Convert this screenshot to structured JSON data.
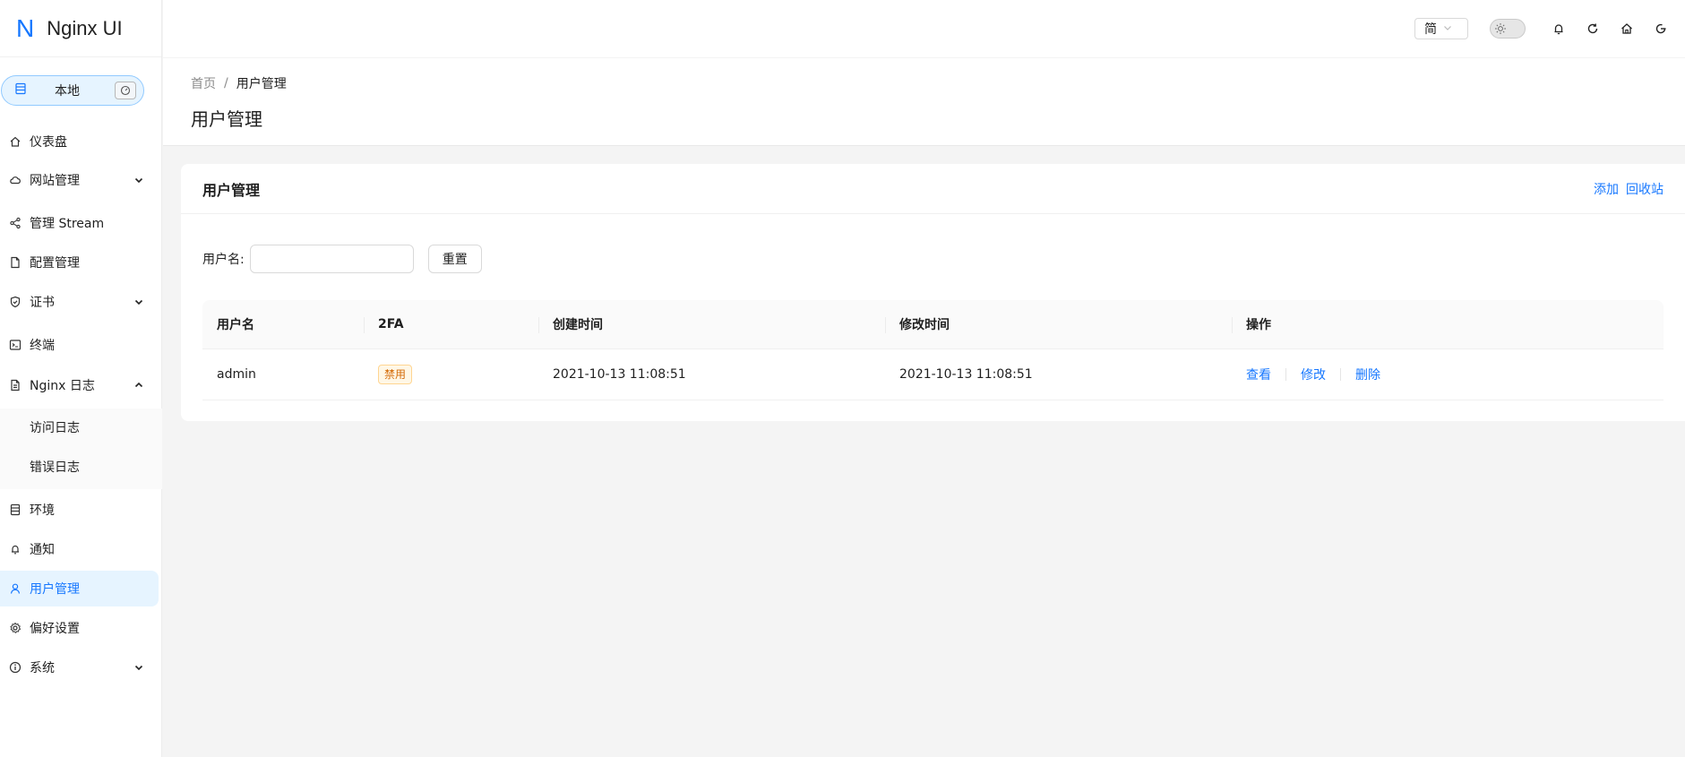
{
  "app": {
    "logo_mark": "N",
    "name": "Nginx UI"
  },
  "env": {
    "label": "本地"
  },
  "sidebar": {
    "items": [
      {
        "label": "仪表盘",
        "icon": "home-icon"
      },
      {
        "label": "网站管理",
        "icon": "cloud-icon",
        "expandable": true
      },
      {
        "label": "管理 Stream",
        "icon": "share-icon"
      },
      {
        "label": "配置管理",
        "icon": "file-icon"
      },
      {
        "label": "证书",
        "icon": "shield-icon",
        "expandable": true
      },
      {
        "label": "终端",
        "icon": "terminal-icon"
      },
      {
        "label": "Nginx 日志",
        "icon": "file-text-icon",
        "expandable": true,
        "expanded": true
      },
      {
        "label": "访问日志",
        "sub": true
      },
      {
        "label": "错误日志",
        "sub": true
      },
      {
        "label": "环境",
        "icon": "database-icon"
      },
      {
        "label": "通知",
        "icon": "bell-icon"
      },
      {
        "label": "用户管理",
        "icon": "user-icon",
        "active": true
      },
      {
        "label": "偏好设置",
        "icon": "gear-icon"
      },
      {
        "label": "系统",
        "icon": "info-icon",
        "expandable": true
      }
    ]
  },
  "topbar": {
    "language": "简"
  },
  "breadcrumb": {
    "home": "首页",
    "separator": "/",
    "current": "用户管理"
  },
  "page": {
    "title": "用户管理"
  },
  "card": {
    "title": "用户管理",
    "add_label": "添加",
    "trash_label": "回收站",
    "search_label": "用户名:",
    "search_value": "",
    "reset_label": "重置"
  },
  "table": {
    "columns": [
      "用户名",
      "2FA",
      "创建时间",
      "修改时间",
      "操作"
    ],
    "rows": [
      {
        "username": "admin",
        "twofa": "禁用",
        "created": "2021-10-13 11:08:51",
        "modified": "2021-10-13 11:08:51",
        "actions": [
          "查看",
          "修改",
          "删除"
        ]
      }
    ]
  },
  "colors": {
    "accent": "#1677ff",
    "active_bg": "#e6f4ff",
    "tag_text": "#d46b08",
    "tag_bg": "#fff7e6"
  }
}
